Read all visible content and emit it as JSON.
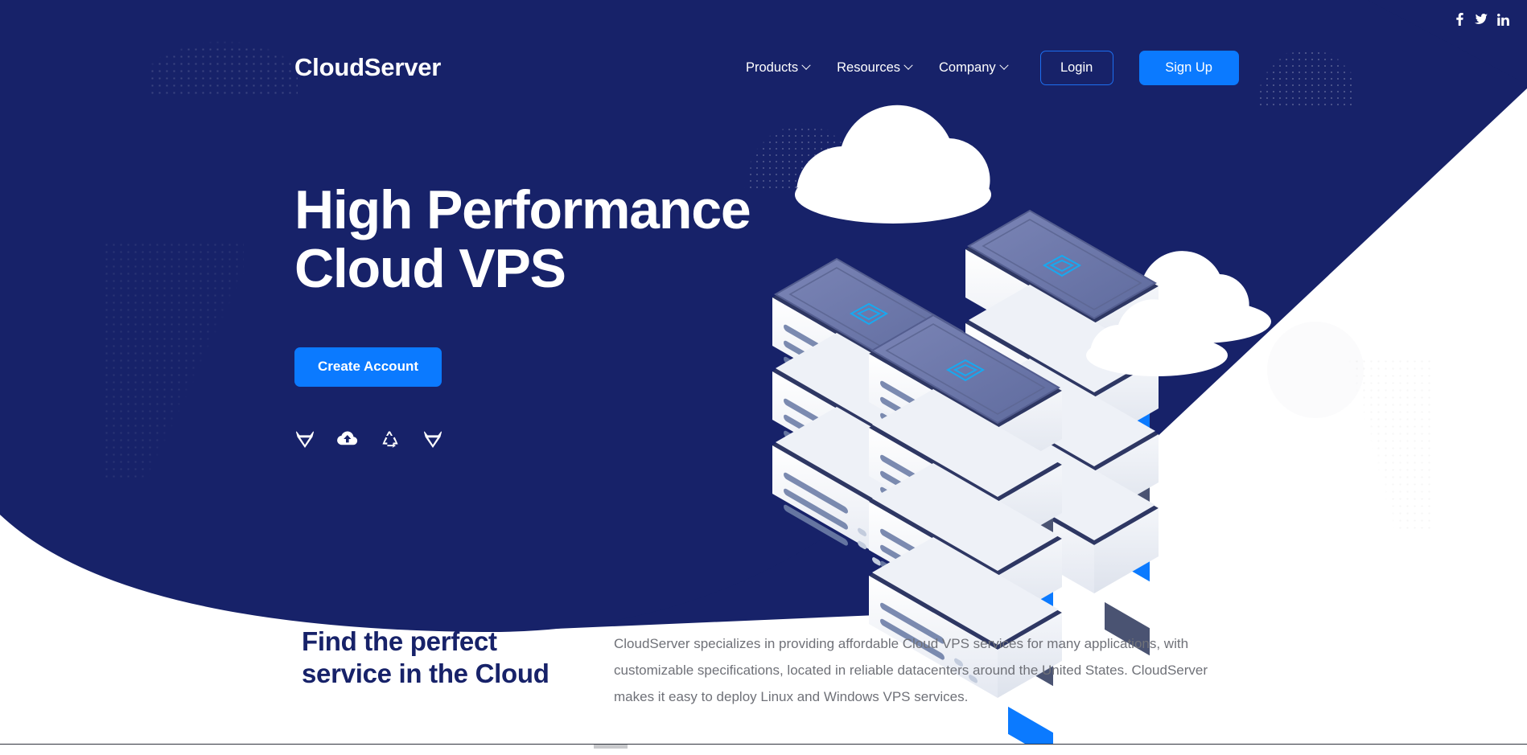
{
  "brand": {
    "name": "CloudServer"
  },
  "social": [
    {
      "name": "facebook",
      "label": "Facebook"
    },
    {
      "name": "twitter",
      "label": "Twitter"
    },
    {
      "name": "linkedin",
      "label": "LinkedIn"
    }
  ],
  "nav": {
    "items": [
      {
        "label": "Products",
        "has_dropdown": true
      },
      {
        "label": "Resources",
        "has_dropdown": true
      },
      {
        "label": "Company",
        "has_dropdown": true
      }
    ],
    "login_label": "Login",
    "signup_label": "Sign Up"
  },
  "hero": {
    "title": "High Performance\nCloud VPS",
    "cta_label": "Create Account",
    "os_logos": [
      {
        "name": "gitlab-fox-logo"
      },
      {
        "name": "cloud-upload-logo"
      },
      {
        "name": "recycle-logo"
      },
      {
        "name": "gitlab-fox-logo-2"
      }
    ]
  },
  "lower": {
    "heading": "Find the perfect service in the Cloud",
    "body": "CloudServer specializes in providing affordable Cloud VPS services for many applications, with customizable specifications, located in reliable datacenters around the United States. CloudServer makes it easy to deploy Linux and Windows VPS services."
  },
  "colors": {
    "navy": "#172269",
    "accent_blue": "#0b7aff",
    "login_border": "#1d6ef0",
    "body_text": "#6f7178",
    "heading_navy": "#172269",
    "server_top": "#6b76a8",
    "server_body": "#f2f4f8",
    "server_edge": "#2e3763",
    "screen_blue": "#0b7aff",
    "screen_dark": "#4a5372",
    "chip_cyan": "#17a9f0"
  }
}
